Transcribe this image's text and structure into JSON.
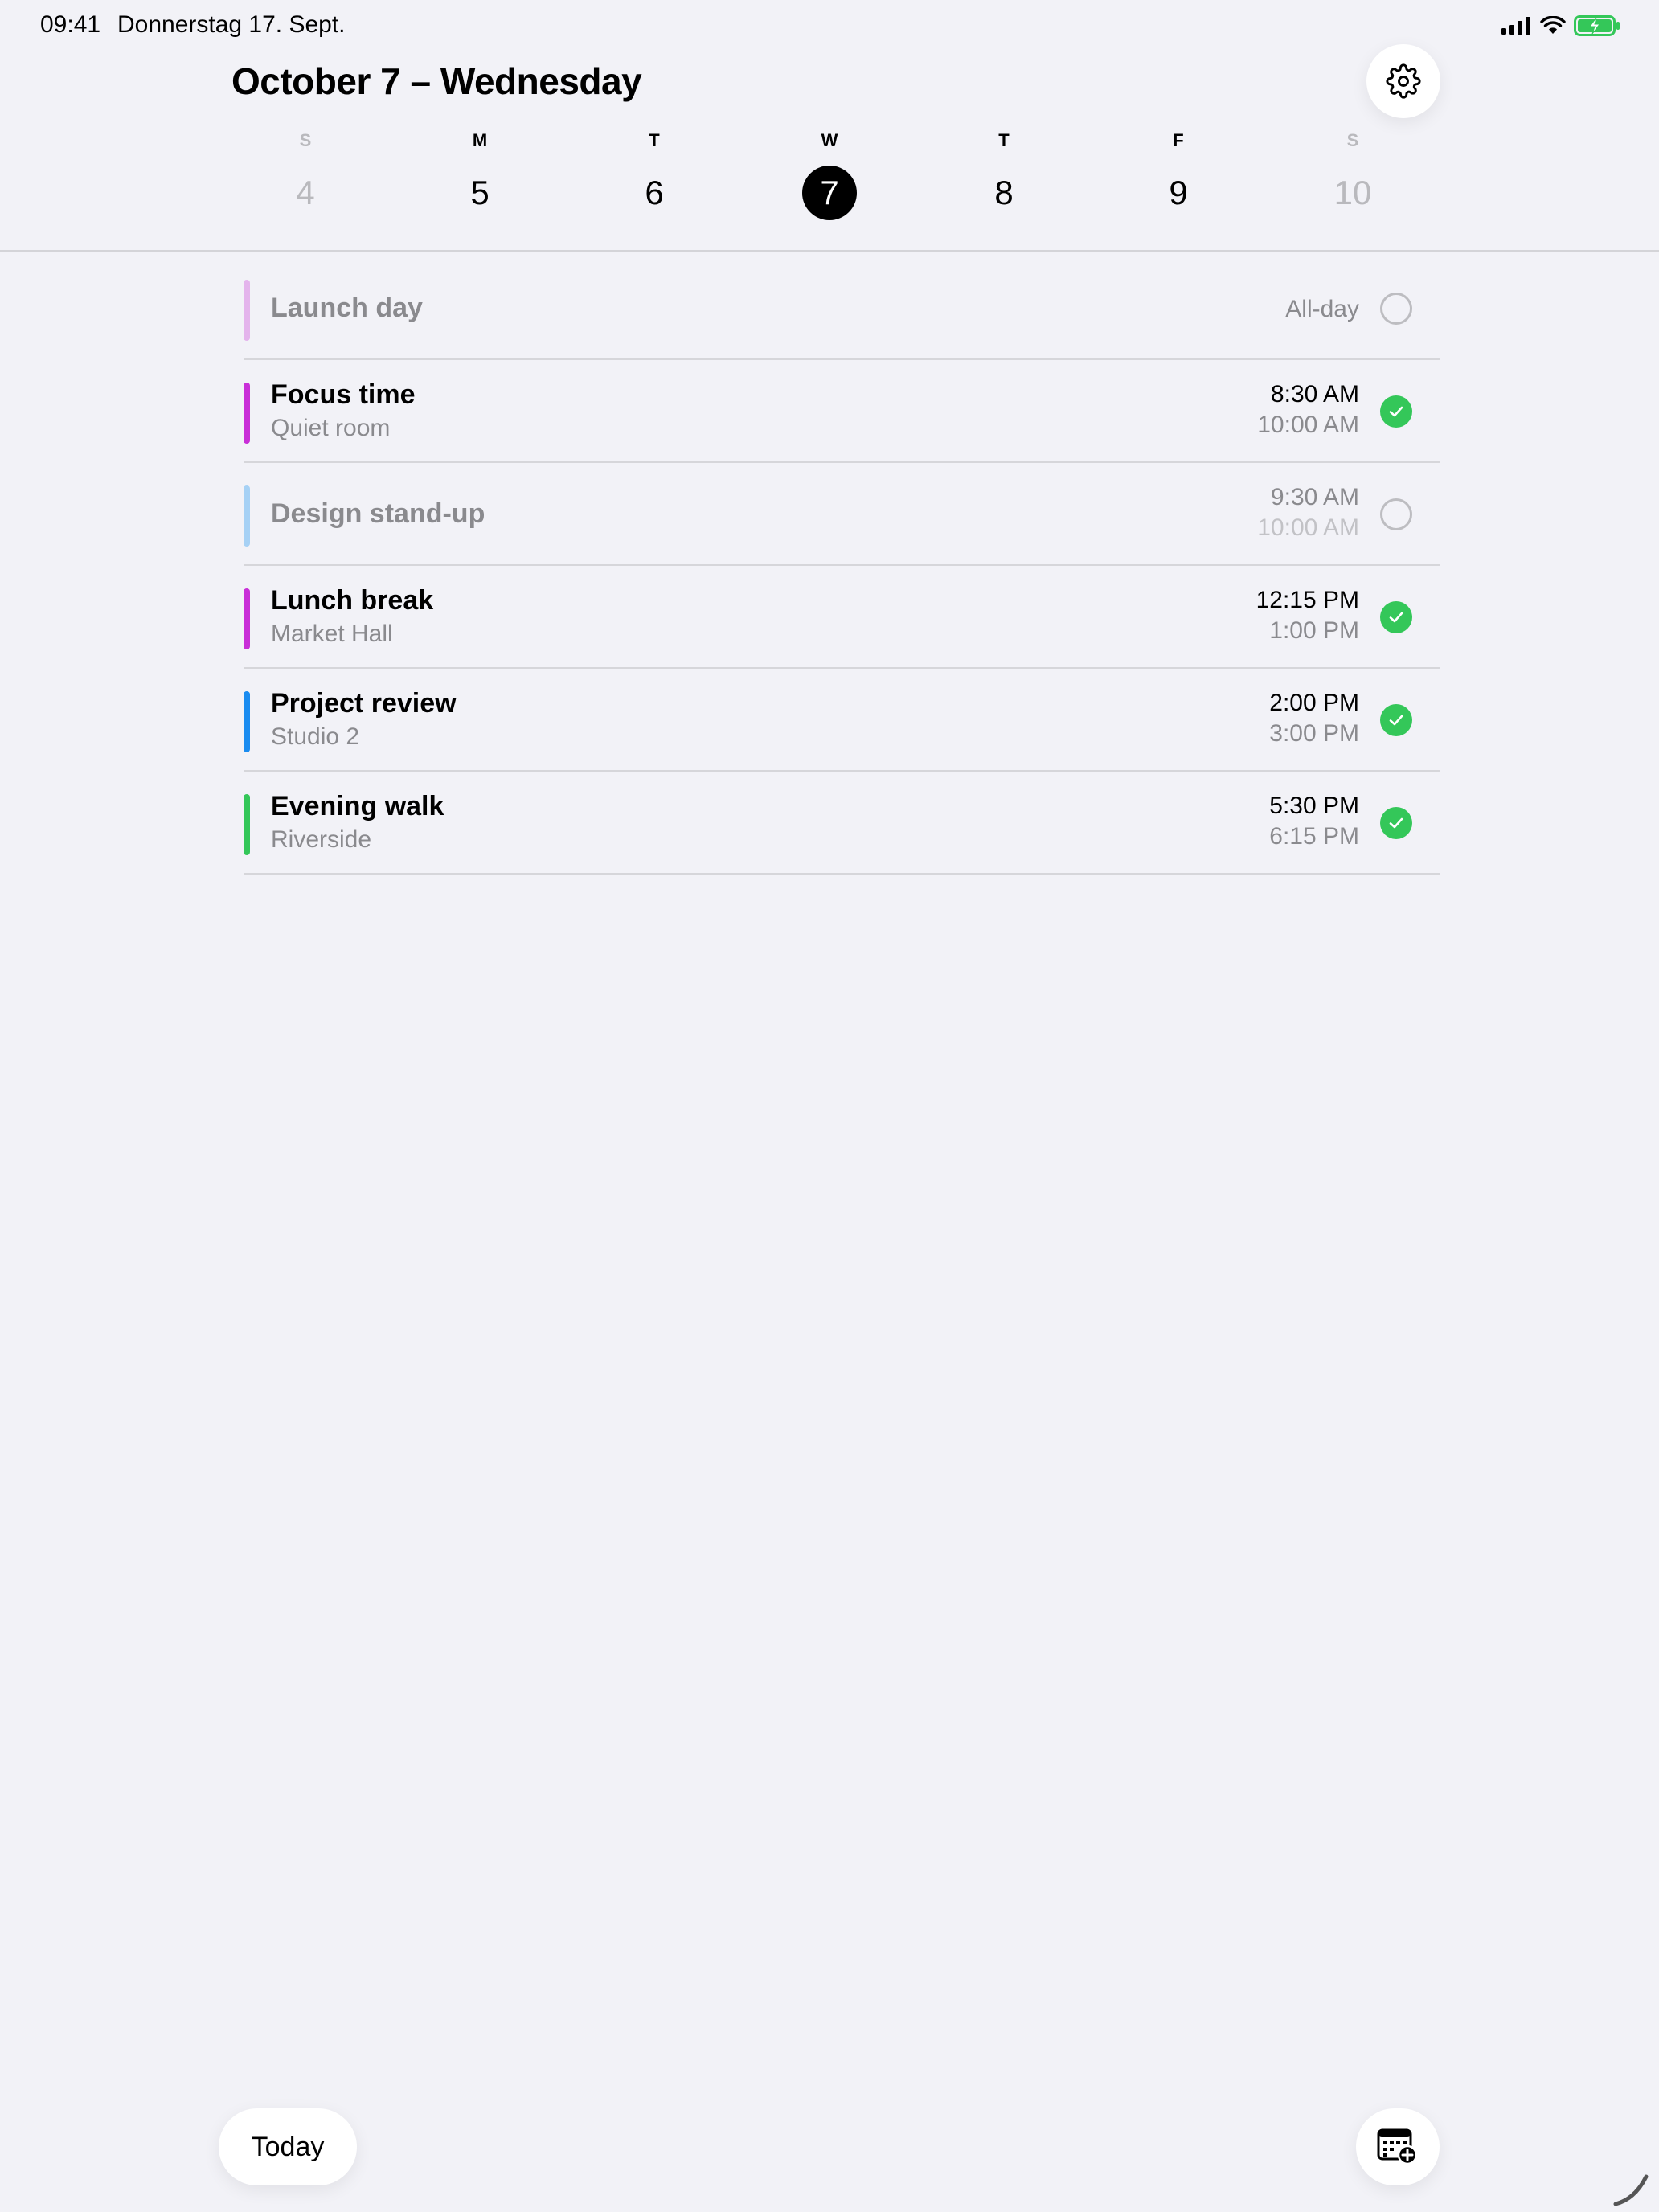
{
  "status_bar": {
    "time": "09:41",
    "date": "Donnerstag 17. Sept."
  },
  "header": {
    "title": "October 7 – Wednesday"
  },
  "week": {
    "days": [
      {
        "letter": "S",
        "number": "4"
      },
      {
        "letter": "M",
        "number": "5"
      },
      {
        "letter": "T",
        "number": "6"
      },
      {
        "letter": "W",
        "number": "7"
      },
      {
        "letter": "T",
        "number": "8"
      },
      {
        "letter": "F",
        "number": "9"
      },
      {
        "letter": "S",
        "number": "10"
      }
    ],
    "selected_index": 3
  },
  "events": [
    {
      "title": "Launch day",
      "subtitle": "",
      "start": "",
      "end": "",
      "all_day_label": "All-day",
      "color": "#e4b4ec",
      "completed": false
    },
    {
      "title": "Focus time",
      "subtitle": "Quiet room",
      "start": "8:30 AM",
      "end": "10:00 AM",
      "color": "#c92fd8",
      "completed": true
    },
    {
      "title": "Design stand-up",
      "subtitle": "",
      "start": "9:30 AM",
      "end": "10:00 AM",
      "color": "#a6d1f5",
      "completed": false
    },
    {
      "title": "Lunch break",
      "subtitle": "Market Hall",
      "start": "12:15 PM",
      "end": "1:00 PM",
      "color": "#c92fd8",
      "completed": true
    },
    {
      "title": "Project review",
      "subtitle": "Studio 2",
      "start": "2:00 PM",
      "end": "3:00 PM",
      "color": "#1a8cf0",
      "completed": true
    },
    {
      "title": "Evening walk",
      "subtitle": "Riverside",
      "start": "5:30 PM",
      "end": "6:15 PM",
      "color": "#34c759",
      "completed": true
    }
  ],
  "bottom": {
    "today_label": "Today"
  },
  "icons": {
    "settings": "gear-icon",
    "add_event": "calendar-add-icon",
    "completed": "checkmark-icon"
  },
  "colors": {
    "background": "#f2f2f7",
    "complete": "#34c759",
    "selected_day": "#000000"
  }
}
